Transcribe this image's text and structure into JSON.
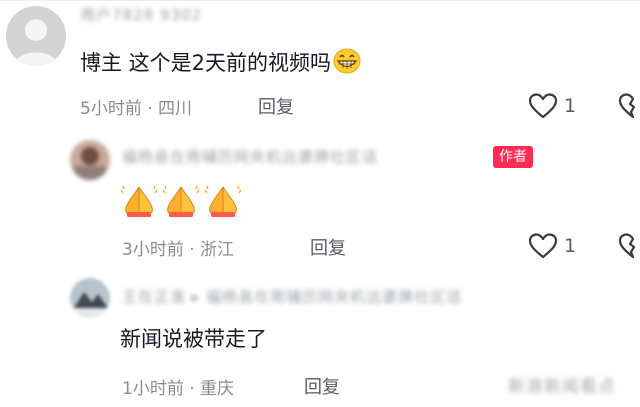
{
  "comments": [
    {
      "username": "用户7828 9302",
      "text": "博主 这个是2天前的视频吗",
      "emoji": "😁",
      "time_location": "5小时前 · 四川",
      "reply_label": "回复",
      "likes": "1"
    },
    {
      "username": "福杨县在雨辅历网央机远婆牌社区话",
      "author_badge": "作者",
      "text": "🙏🙏🙏",
      "time_location": "3小时前 · 浙江",
      "reply_label": "回复",
      "likes": "1"
    },
    {
      "username": "王在正准 ▸ 福杨县在雨辅历网央机远婆牌社区话",
      "text": "新闻说被带走了",
      "time_location": "1小时前 · 重庆",
      "reply_label": "回复"
    }
  ],
  "watermark": "新浪新闻看点",
  "colors": {
    "author_badge": "#fe2c55",
    "meta": "#8a8b91",
    "text": "#161823"
  },
  "icons": [
    "heart-outline-icon",
    "broken-heart-icon",
    "avatar-placeholder-icon",
    "emoji-grin",
    "emoji-pray"
  ]
}
